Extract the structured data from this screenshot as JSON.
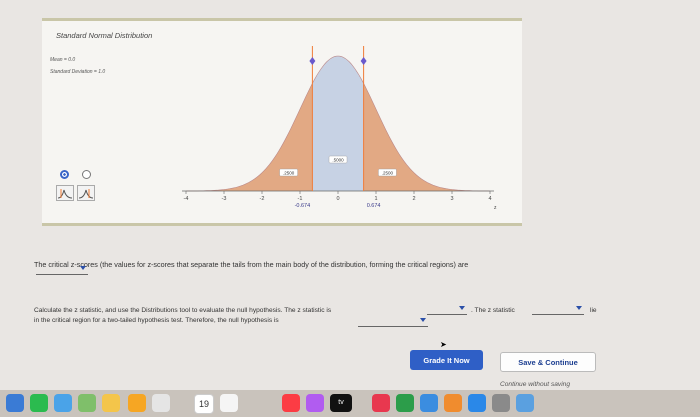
{
  "panel": {
    "title": "Standard Normal Distribution",
    "mean_label": "Mean = 0.0",
    "sd_label": "Standard Deviation = 1.0"
  },
  "chart_data": {
    "type": "area",
    "x_ticks": [
      "-4",
      "-3",
      "-2",
      "-1",
      "0",
      "1",
      "2",
      "3",
      "4"
    ],
    "x_axis_label": "z",
    "critical_values": [
      -0.674,
      0.674
    ],
    "critical_labels": [
      "-0.674",
      "0.674"
    ],
    "regions": [
      {
        "from": -4,
        "to": -0.674,
        "area_label": ".2500",
        "color": "#e2a984"
      },
      {
        "from": -0.674,
        "to": 0.674,
        "area_label": ".5000",
        "color": "#c7d2e4"
      },
      {
        "from": 0.674,
        "to": 4,
        "area_label": ".2500",
        "color": "#e2a984"
      }
    ],
    "colors": {
      "tail": "#e2a984",
      "center": "#c7d2e4",
      "line": "#f07b36",
      "axis": "#666"
    }
  },
  "question": {
    "critical_prompt": "The critical z-scores (the values for z-scores that separate the tails from the main body of the distribution, forming the critical regions) are",
    "line1_start": "Calculate the z statistic, and use the Distributions tool to evaluate the null hypothesis. The z statistic is",
    "line1_end": ". The z statistic",
    "line1_tail": "lie",
    "line2_start": "in the critical region for a two-tailed hypothesis test. Therefore, the null hypothesis is"
  },
  "buttons": {
    "grade": "Grade It Now",
    "save": "Save & Continue",
    "continue": "Continue without saving"
  },
  "dock": {
    "calendar_day": "19"
  }
}
